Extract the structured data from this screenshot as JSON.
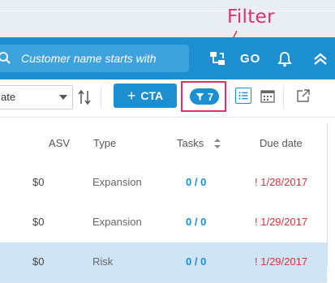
{
  "annotation": {
    "label": "Filter"
  },
  "header": {
    "search_placeholder": "Customer name starts with",
    "go_label": "GO"
  },
  "toolbar": {
    "select_value": "ate",
    "cta_label": "CTA",
    "filter_count": "7"
  },
  "table": {
    "columns": [
      "ASV",
      "Type",
      "Tasks",
      "Due date"
    ],
    "rows": [
      {
        "asv": "$0",
        "type": "Expansion",
        "tasks": "0 / 0",
        "due": "! 1/28/2017",
        "selected": false
      },
      {
        "asv": "$0",
        "type": "Expansion",
        "tasks": "0 / 0",
        "due": "! 1/29/2017",
        "selected": false
      },
      {
        "asv": "$0",
        "type": "Risk",
        "tasks": "0 / 0",
        "due": "! 1/29/2017",
        "selected": true
      }
    ]
  },
  "colors": {
    "brand_blue": "#1b8fd0",
    "annotation_pink": "#e0306f",
    "overdue_red": "#e0303a",
    "selected_row": "#cfe4f5"
  }
}
